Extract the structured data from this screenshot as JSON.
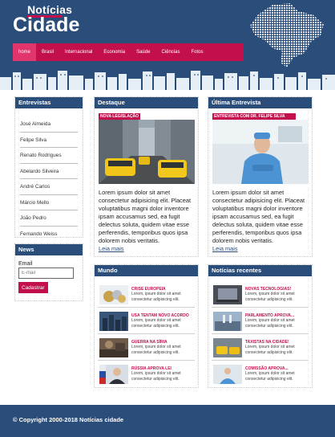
{
  "logo": {
    "top": "Notícias",
    "main": "Cidade"
  },
  "nav": {
    "items": [
      "home",
      "Brasil",
      "Internacional",
      "Economia",
      "Saúde",
      "Ciências",
      "Fotos"
    ]
  },
  "entrevistas": {
    "title": "Entrevistas",
    "items": [
      "José Almeida",
      "Felipe Silva",
      "Renato Rodrigues",
      "Abelardo Silveira",
      "André Carlos",
      "Márcio Mello",
      "João Pedro",
      "Fernando Weiss"
    ]
  },
  "news": {
    "title": "News",
    "label": "Email",
    "placeholder": "E-mail",
    "button": "Cadastrar"
  },
  "destaque": {
    "title": "Destaque",
    "tag": "NOVA LEGISLAÇÃO",
    "text": "Lorem ipsum dolor sit amet consectetur adipisicing elit. Placeat voluptatibus magni dolor inventore ipsam accusamus sed, ea fugit delectus soluta, quidem vitae esse perferendis, temporibus quos ipsa dolorem nobis veritatis.",
    "link": "Leia mais"
  },
  "ultima": {
    "title": "Última Entrevista",
    "tag": "ENTREVISTA COM DR. FELIPE SILVA",
    "text": "Lorem ipsum dolor sit amet consectetur adipisicing elit. Placeat voluptatibus magni dolor inventore ipsam accusamus sed, ea fugit delectus soluta, quidem vitae esse perferendis, temporibus quos ipsa dolorem nobis veritatis.",
    "link": "Leia mais"
  },
  "mundo": {
    "title": "Mundo",
    "items": [
      {
        "title": "CRISE EUROPEIA",
        "text": "Lorem, ipsum dolor sit amet consectetur adipisicing elit."
      },
      {
        "title": "USA TENTAM NOVO ACORDO",
        "text": "Lorem, ipsum dolor sit amet consectetur adipisicing elit."
      },
      {
        "title": "GUERRA NA SÍRIA",
        "text": "Lorem, ipsum dolor sit amet consectetur adipisicing elit."
      },
      {
        "title": "RÚSSIA APROVA LEI",
        "text": "Lorem, ipsum dolor sit amet consectetur adipisicing elit."
      }
    ]
  },
  "recentes": {
    "title": "Notícias recentes",
    "items": [
      {
        "title": "NOVAS TECNOLOGIAS!",
        "text": "Lorem, ipsum dolor sit amet consectetur adipisicing elit."
      },
      {
        "title": "PARLAMENTO APROVA...",
        "text": "Lorem, ipsum dolor sit amet consectetur adipisicing elit."
      },
      {
        "title": "TAXISTAS NA CIDADE!",
        "text": "Lorem, ipsum dolor sit amet consectetur adipisicing elit."
      },
      {
        "title": "COMISSÃO APROVA...",
        "text": "Lorem, ipsum dolor sit amet consectetur adipisicing elit."
      }
    ]
  },
  "footer": {
    "text": "© Copyright 2000-2018 Notícias cidade"
  },
  "colors": {
    "primary": "#2b4d7a",
    "accent": "#c40f4d",
    "accent_light": "#e0356d"
  }
}
